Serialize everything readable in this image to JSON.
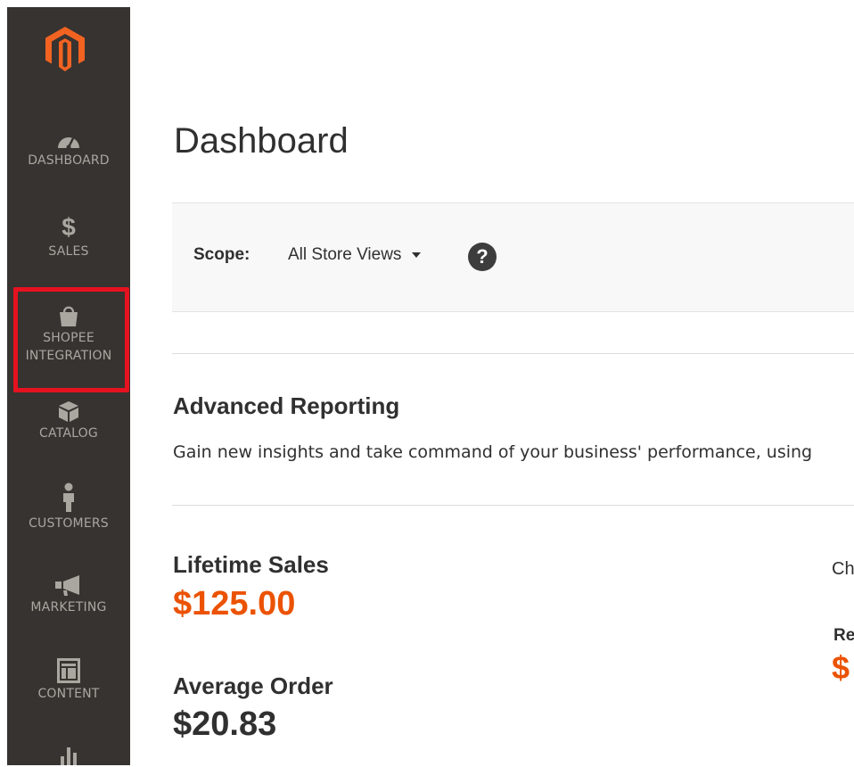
{
  "sidebar": {
    "logo": "magento-logo",
    "items": [
      {
        "label": "DASHBOARD",
        "icon": "speedometer-icon"
      },
      {
        "label": "SALES",
        "icon": "dollar-icon"
      },
      {
        "label_line1": "SHOPEE",
        "label_line2": "INTEGRATION",
        "icon": "shopping-bag-icon"
      },
      {
        "label": "CATALOG",
        "icon": "box-icon"
      },
      {
        "label": "CUSTOMERS",
        "icon": "person-icon"
      },
      {
        "label": "MARKETING",
        "icon": "megaphone-icon"
      },
      {
        "label": "CONTENT",
        "icon": "layout-icon"
      },
      {
        "label": "",
        "icon": "bar-chart-icon"
      }
    ]
  },
  "page": {
    "title": "Dashboard"
  },
  "scope": {
    "label": "Scope:",
    "value": "All Store Views",
    "help": "?"
  },
  "advanced_reporting": {
    "title": "Advanced Reporting",
    "text": "Gain new insights and take command of your business' performance, using"
  },
  "stats": {
    "lifetime_label": "Lifetime Sales",
    "lifetime_value": "$125.00",
    "average_label": "Average Order",
    "average_value": "$20.83"
  },
  "right_column": {
    "top": "Ch",
    "middle": "Re",
    "value": "$"
  },
  "colors": {
    "accent": "#eb5202",
    "sidebar": "#373330",
    "highlight": "#e6121f"
  }
}
